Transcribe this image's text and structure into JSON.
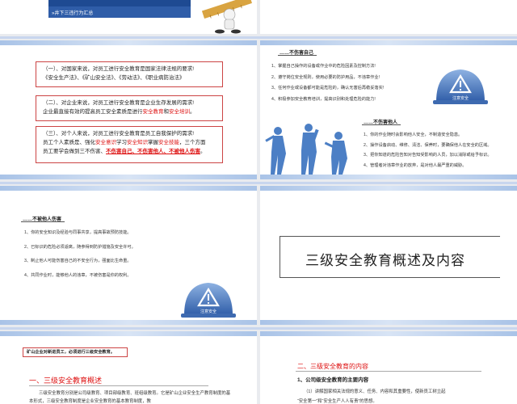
{
  "s1": {
    "menu_item": "»井下三违行为汇总"
  },
  "s2": {
    "box1": [
      "（一）、对国家来说，对员工进行安全教育是国家法律法规的要求!",
      "《安全生产法》、《矿山安全法》、《劳动法》、《职业病防治法》"
    ],
    "box2_line1": "（二）、对企业来说，对员工进行安全教育是企业生存发展的需求!",
    "box2_line2_a": "企业最直接有效的提高员工安全素质是进行",
    "box2_line2_b": "安全教育",
    "box2_line2_c": "和",
    "box2_line2_d": "安全培训",
    "box2_line2_e": "。",
    "box3_line1": "（三）、对个人来说，对员工进行安全教育是员工自我保护的需求!",
    "box3_line2_a": "员工个人素质是、强化",
    "box3_line2_b": "安全意识",
    "box3_line2_c": "学习",
    "box3_line2_d": "安全知识",
    "box3_line2_e": "掌握",
    "box3_line2_f": "安全技能",
    "box3_line2_g": "，三个方面",
    "box3_line3_a": "员工要学会做到三不伤害、",
    "box3_line3_b": "不伤害自己、不伤害他人、不被他人伤害",
    "box3_line3_c": "。"
  },
  "s3": {
    "title1": "……不伤害自己",
    "items1": [
      "1、掌握自己操作的设备或作业中的危险因素及控制方法!",
      "2、遵守岗位安全规则，使用必要的防护用品，不违章作业!",
      "3、任何作业或设备都可能是危险的，确认无害后再稳妥落实!",
      "4、积极参加安全教育培训，提高识别和处理危险的能力!"
    ],
    "helmet_text": "注意安全",
    "title2": "……不伤害他人",
    "items2": [
      "1、你的作业随时会影响他人安全，不制造安全隐患。",
      "2、操作设备启动、维修、清洁、保养时，要确保他人在安全的区域。",
      "3、把你知道的危险告知对告知受影响的人员，加以消除或给予标识。",
      "4、管理者对违章作业的放弃，是对他人最严重的威胁。"
    ]
  },
  "s4": {
    "title": "……不被他人伤害",
    "items": [
      "1、你的安全知识及经验与同事共享，提高事故预防技能。",
      "2、已标识的危险必须适离，随参得到防护措施及安全许可。",
      "3、制止他人可能伤害自己的不安全行为，强面比生命重。",
      "4、共同作业时，能够他人的违章，不被伤害是你的权利。"
    ],
    "helmet_text": "注意安全"
  },
  "s5": {
    "title": "三级安全教育概述及内容"
  },
  "s6": {
    "note": "矿山企业对新进员工，必须进行三级安全教育。",
    "heading": "一、三级安全教育概述",
    "body": "三级安全教育分别是公司级教育、项目部级教育、班组级教育。它是矿山企业安全生产教育制度的基本形式，三级安全教育制度是企业安全教育的基本教育制度，教"
  },
  "s7": {
    "heading": "二、三级安全教育的内容",
    "sub": "1、公司级安全教育的主要内容",
    "body1": "（1）讲解国家相关法规的意义、任务、内容和其重要性，使新员工树立起",
    "body2": "“安全第一”和“安全生产人人有责”的思想。"
  },
  "colors": {
    "accent_blue": "#2f5da8",
    "accent_red": "#d11111",
    "frame_light": "#c8d6ee"
  }
}
